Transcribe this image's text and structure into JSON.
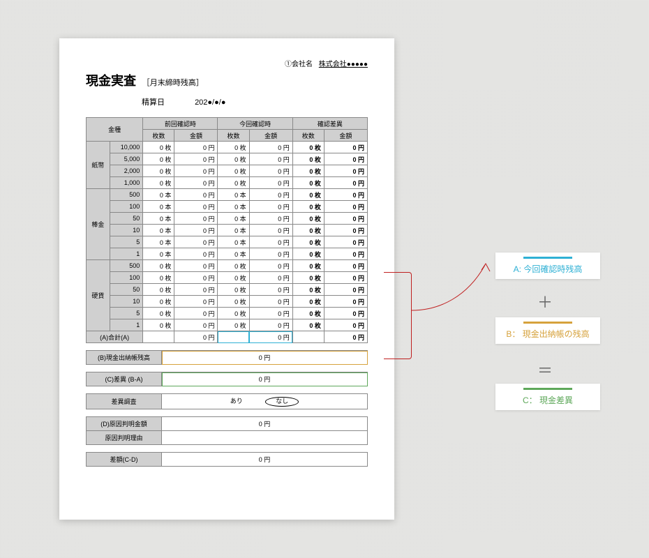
{
  "company": {
    "label": "①会社名",
    "value": "株式会社●●●●●"
  },
  "title": "現金実査",
  "subtitle": "［月末締時残高］",
  "date": {
    "label": "精算日",
    "value": "202●/●/●"
  },
  "headers": {
    "kind": "金種",
    "prev": "前回確認時",
    "curr": "今回確認時",
    "diff": "確認差異",
    "qty": "枚数",
    "amt": "金額"
  },
  "unit": {
    "sheets": "枚",
    "sticks": "本",
    "yen": "円"
  },
  "categories": [
    {
      "name": "紙幣",
      "unit": "枚",
      "denoms": [
        "10,000",
        "5,000",
        "2,000",
        "1,000"
      ]
    },
    {
      "name": "棒金",
      "unit": "本",
      "denoms": [
        "500",
        "100",
        "50",
        "10",
        "5",
        "1"
      ]
    },
    {
      "name": "硬貨",
      "unit": "枚",
      "denoms": [
        "500",
        "100",
        "50",
        "10",
        "5",
        "1"
      ]
    }
  ],
  "totals": {
    "label": "(A)合計(A)",
    "prev_amt": "0 円",
    "curr_amt": "0 円",
    "diff_amt": "0 円"
  },
  "balance": {
    "label": "(B)現金出納帳残高",
    "value": "0 円"
  },
  "diff": {
    "label": "(C)差異 (B-A)",
    "value": "0 円"
  },
  "survey": {
    "label": "差異調査",
    "ari": "あり",
    "nashi": "なし"
  },
  "cause_amt": {
    "label": "(D)原因判明金額",
    "value": "0 円"
  },
  "cause_reason": {
    "label": "原因判明理由",
    "value": ""
  },
  "net": {
    "label": "差額(C-D)",
    "value": "0 円"
  },
  "annotations": {
    "a": "A: 今回確認時残高",
    "plus": "＋",
    "b": "B： 現金出納帳の残高",
    "eq": "＝",
    "c": "C： 現金差異"
  },
  "zero": "0"
}
